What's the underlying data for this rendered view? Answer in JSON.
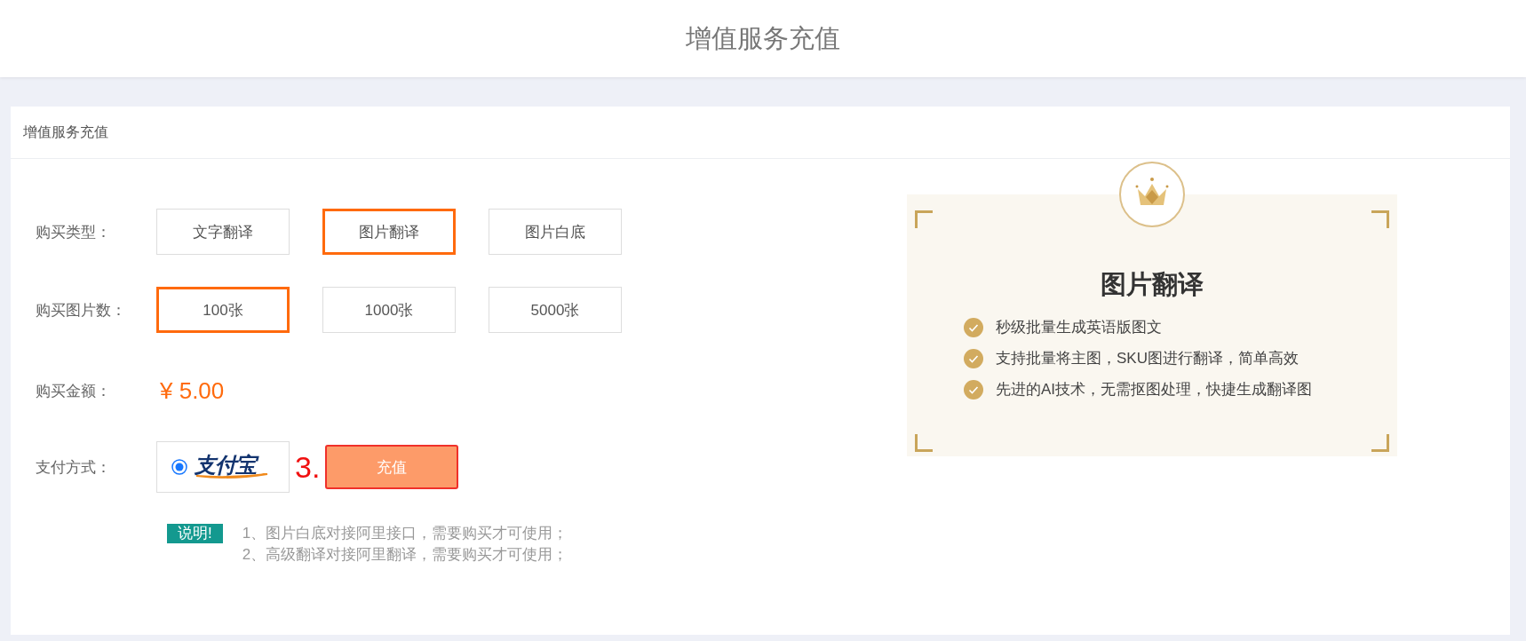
{
  "page_title": "增值服务充值",
  "panel": {
    "title": "增值服务充值"
  },
  "form": {
    "purchase_type": {
      "label": "购买类型：",
      "options": [
        {
          "label": "文字翻译",
          "selected": false
        },
        {
          "label": "图片翻译",
          "selected": true
        },
        {
          "label": "图片白底",
          "selected": false
        }
      ]
    },
    "image_count": {
      "label": "购买图片数：",
      "options": [
        {
          "label": "100张",
          "selected": true
        },
        {
          "label": "1000张",
          "selected": false
        },
        {
          "label": "5000张",
          "selected": false
        }
      ]
    },
    "amount": {
      "label": "购买金额：",
      "value": "¥ 5.00"
    },
    "payment": {
      "label": "支付方式：",
      "methods": [
        {
          "logo_text": "支付宝",
          "selected": true
        }
      ],
      "annotation": "3.",
      "submit": "充值"
    },
    "notes": {
      "badge": "说明!",
      "lines": [
        "1、图片白底对接阿里接口，需要购买才可使用；",
        "2、高级翻译对接阿里翻译，需要购买才可使用；"
      ]
    }
  },
  "feature_card": {
    "title": "图片翻译",
    "features": [
      "秒级批量生成英语版图文",
      "支持批量将主图，SKU图进行翻译，简单高效",
      "先进的AI技术，无需抠图处理，快捷生成翻译图"
    ]
  }
}
